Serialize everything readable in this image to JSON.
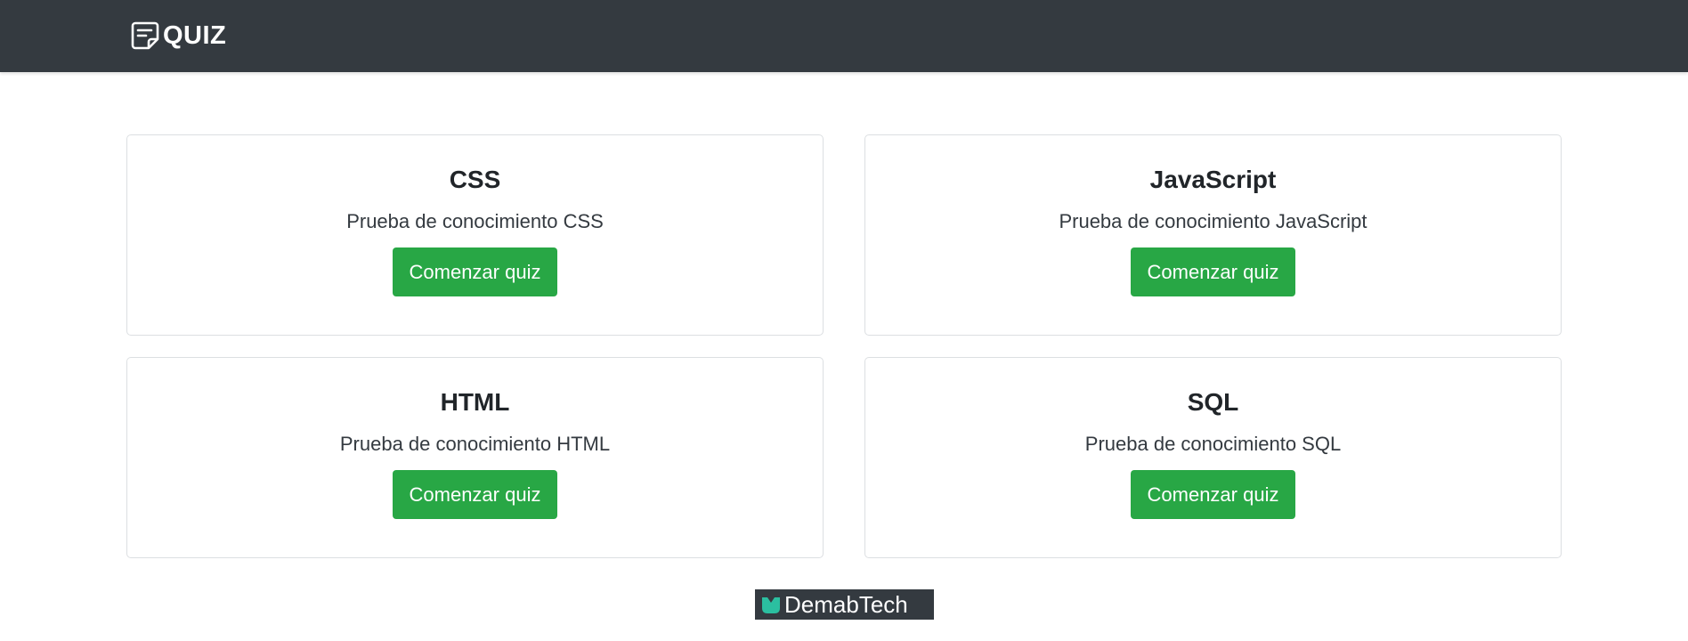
{
  "navbar": {
    "brand_icon": "quiz-note-icon",
    "brand_label": "QUIZ",
    "background_color": "#343a40"
  },
  "quizzes": [
    {
      "title": "CSS",
      "description": "Prueba de conocimiento CSS",
      "button_label": "Comenzar quiz"
    },
    {
      "title": "JavaScript",
      "description": "Prueba de conocimiento JavaScript",
      "button_label": "Comenzar quiz"
    },
    {
      "title": "HTML",
      "description": "Prueba de conocimiento HTML",
      "button_label": "Comenzar quiz"
    },
    {
      "title": "SQL",
      "description": "Prueba de conocimiento SQL",
      "button_label": "Comenzar quiz"
    }
  ],
  "button_color": "#28a745",
  "footer": {
    "logo_icon": "demabtech-logo-icon",
    "logo_text": "DemabTech",
    "logo_accent_color": "#2bbfa0"
  }
}
